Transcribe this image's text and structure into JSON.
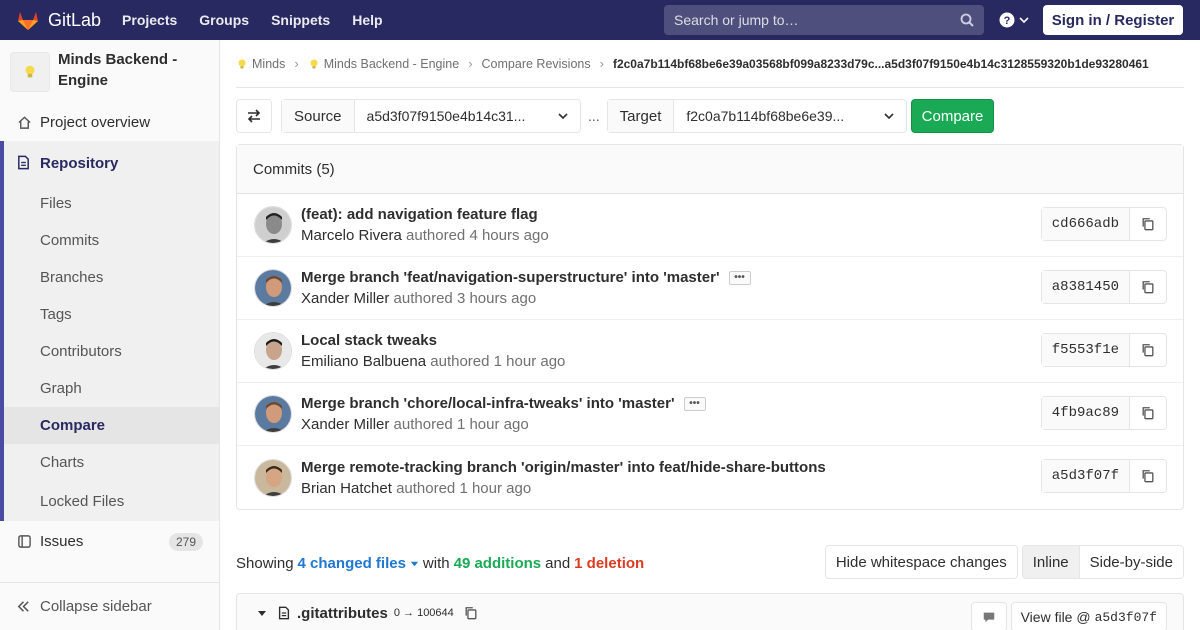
{
  "navbar": {
    "brand": "GitLab",
    "links": [
      "Projects",
      "Groups",
      "Snippets",
      "Help"
    ],
    "search_placeholder": "Search or jump to…",
    "signin": "Sign in / Register"
  },
  "sidebar": {
    "project_name": "Minds Backend - Engine",
    "overview": "Project overview",
    "repository": "Repository",
    "repo_items": [
      "Files",
      "Commits",
      "Branches",
      "Tags",
      "Contributors",
      "Graph",
      "Compare",
      "Charts",
      "Locked Files"
    ],
    "issues": "Issues",
    "issues_count": "279",
    "collapse": "Collapse sidebar"
  },
  "breadcrumb": {
    "group": "Minds",
    "project": "Minds Backend - Engine",
    "section": "Compare Revisions",
    "current": "f2c0a7b114bf68be6e39a03568bf099a8233d79c...a5d3f07f9150e4b14c3128559320b1de93280461"
  },
  "compare": {
    "source_label": "Source",
    "source_value": "a5d3f07f9150e4b14c31...",
    "separator": "...",
    "target_label": "Target",
    "target_value": "f2c0a7b114bf68be6e39...",
    "button": "Compare"
  },
  "commits": {
    "header": "Commits (5)",
    "authored_word": "authored",
    "items": [
      {
        "title": "(feat): add navigation feature flag",
        "author": "Marcelo Rivera",
        "ago": "4 hours ago",
        "sha": "cd666adb",
        "has_more": false
      },
      {
        "title": "Merge branch 'feat/navigation-superstructure' into 'master'",
        "author": "Xander Miller",
        "ago": "3 hours ago",
        "sha": "a8381450",
        "has_more": true
      },
      {
        "title": "Local stack tweaks",
        "author": "Emiliano Balbuena",
        "ago": "1 hour ago",
        "sha": "f5553f1e",
        "has_more": false
      },
      {
        "title": "Merge branch 'chore/local-infra-tweaks' into 'master'",
        "author": "Xander Miller",
        "ago": "1 hour ago",
        "sha": "4fb9ac89",
        "has_more": true
      },
      {
        "title": "Merge remote-tracking branch 'origin/master' into feat/hide-share-buttons",
        "author": "Brian Hatchet",
        "ago": "1 hour ago",
        "sha": "a5d3f07f",
        "has_more": false
      }
    ]
  },
  "stats": {
    "showing": "Showing",
    "changed_files": "4 changed files",
    "with": "with",
    "additions": "49 additions",
    "and": "and",
    "deletions": "1 deletion",
    "hide_whitespace": "Hide whitespace changes",
    "inline": "Inline",
    "side_by_side": "Side-by-side"
  },
  "file": {
    "name": ".gitattributes",
    "mode": "0 → 100644",
    "view_file": "View file @",
    "view_sha": "a5d3f07f"
  }
}
